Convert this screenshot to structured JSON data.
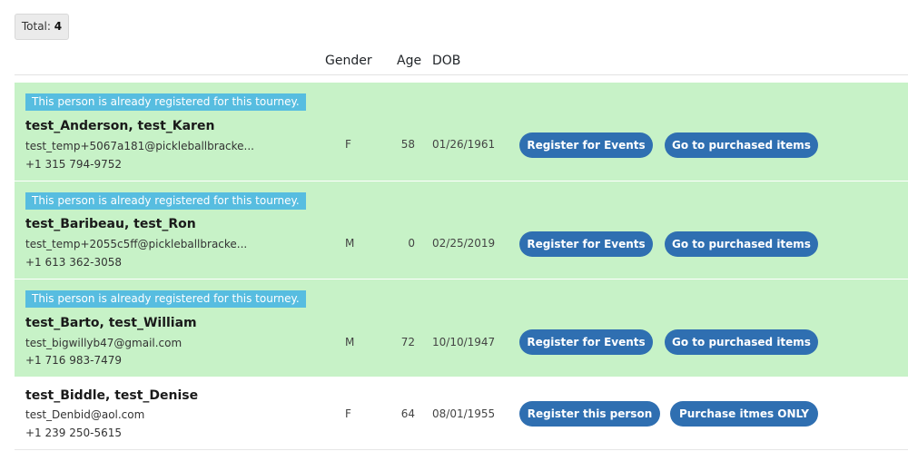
{
  "summary": {
    "total_label": "Total:",
    "total_count": "4"
  },
  "headers": {
    "gender": "Gender",
    "age": "Age",
    "dob": "DOB"
  },
  "rows": [
    {
      "notice": "This person is already registered for this tourney.",
      "name": "test_Anderson, test_Karen",
      "email": "test_temp+5067a181@pickleballbracke...",
      "phone": "+1 315 794-9752",
      "gender": "F",
      "age": "58",
      "dob": "01/26/1961",
      "button1": "Register for Events",
      "button2": "Go to purchased items"
    },
    {
      "notice": "This person is already registered for this tourney.",
      "name": "test_Baribeau, test_Ron",
      "email": "test_temp+2055c5ff@pickleballbracke...",
      "phone": "+1 613 362-3058",
      "gender": "M",
      "age": "0",
      "dob": "02/25/2019",
      "button1": "Register for Events",
      "button2": "Go to purchased items"
    },
    {
      "notice": "This person is already registered for this tourney.",
      "name": "test_Barto, test_William",
      "email": "test_bigwillyb47@gmail.com",
      "phone": "+1 716 983-7479",
      "gender": "M",
      "age": "72",
      "dob": "10/10/1947",
      "button1": "Register for Events",
      "button2": "Go to purchased items"
    },
    {
      "name": "test_Biddle, test_Denise",
      "email": "test_Denbid@aol.com",
      "phone": "+1 239 250-5615",
      "gender": "F",
      "age": "64",
      "dob": "08/01/1955",
      "button1": "Register this person",
      "button2": "Purchase itmes ONLY"
    }
  ],
  "colors": {
    "registered_row": "#c7f2c7",
    "notice": "#57bde0",
    "button": "#2f6fb1"
  }
}
